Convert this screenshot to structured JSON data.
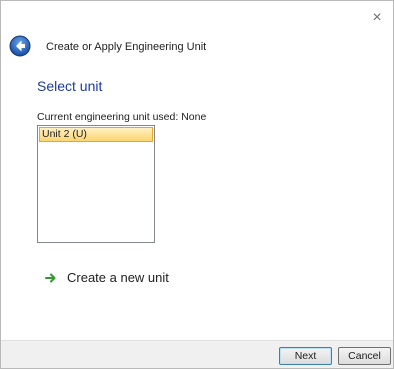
{
  "window": {
    "title": "Create or Apply Engineering Unit",
    "close_label": "×"
  },
  "main": {
    "heading": "Select unit",
    "current_unit_label": "Current engineering unit used:",
    "current_unit_value": "None",
    "units": [
      {
        "label": "Unit 2 (U)",
        "selected": true
      }
    ],
    "create_link": "Create a new unit"
  },
  "footer": {
    "next_label": "Next",
    "cancel_label": "Cancel"
  },
  "colors": {
    "heading": "#1c3b9b",
    "link_arrow": "#2e9b2e",
    "selection_fill": "#fbd56f",
    "selection_border": "#e3a92b"
  },
  "icons": {
    "back": "back-arrow-icon",
    "close": "close-icon",
    "create_link": "green-arrow-icon"
  }
}
